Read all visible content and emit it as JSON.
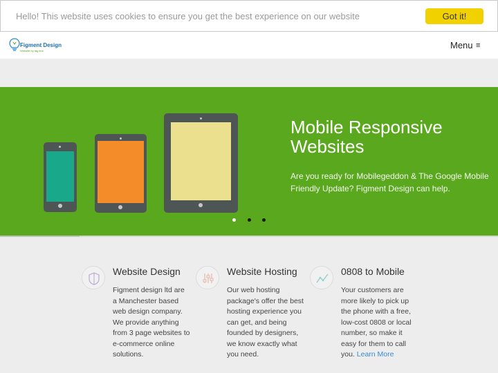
{
  "cookie": {
    "message": "Hello! This website uses cookies to ensure you get the best experience on our website",
    "button_label": "Got it!"
  },
  "header": {
    "logo_text": "Figment Design",
    "logo_tagline": "Website by tag line",
    "menu_label": "Menu",
    "menu_icon": "≡"
  },
  "hero": {
    "title": "Mobile Responsive Websites",
    "text": "Are you ready for Mobilegeddon & The Google Mobile Friendly Update? Figment Design can help.",
    "background": "#5aa81d",
    "devices": [
      {
        "name": "phone",
        "screen_color": "#1aa88a"
      },
      {
        "name": "tablet-small",
        "screen_color": "#f48c2a"
      },
      {
        "name": "tablet-large",
        "screen_color": "#ebe08d"
      }
    ],
    "slider": {
      "slides": 3,
      "active_index": 0
    },
    "progress_fraction": 0.16
  },
  "features": [
    {
      "icon": "shield-icon",
      "title": "Website Design",
      "body": "Figment design ltd are a Manchester based web design company. We provide anything from 3 page websites to e-commerce online solutions."
    },
    {
      "icon": "sliders-icon",
      "title": "Website Hosting",
      "body": "Our web hosting package's offer the best hosting experience you can get, and being founded by designers, we know exactly what you need."
    },
    {
      "icon": "line-chart-icon",
      "title": "0808 to Mobile",
      "body": "Your customers are more likely to pick up the phone with a free, low-cost 0808 or local number, so make it easy for them to call you.",
      "link": "Learn More"
    }
  ],
  "colors": {
    "accent_yellow": "#f2d100",
    "hero_green": "#5aa81d",
    "link_blue": "#3a8ad6"
  }
}
